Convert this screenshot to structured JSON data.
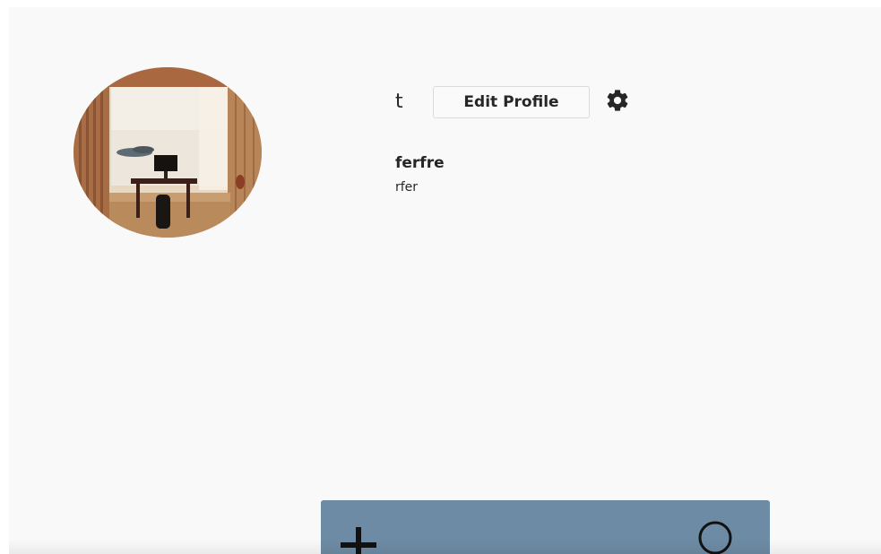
{
  "profile": {
    "username": "t",
    "edit_label": "Edit Profile",
    "full_name": "ferfre",
    "bio": "rfer"
  },
  "icons": {
    "settings": "gear-icon",
    "add": "plus-icon",
    "profile": "user-icon"
  },
  "colors": {
    "page_background": "#f9f9f9",
    "bottom_bar": "#6d8ba4",
    "text": "#262626"
  }
}
